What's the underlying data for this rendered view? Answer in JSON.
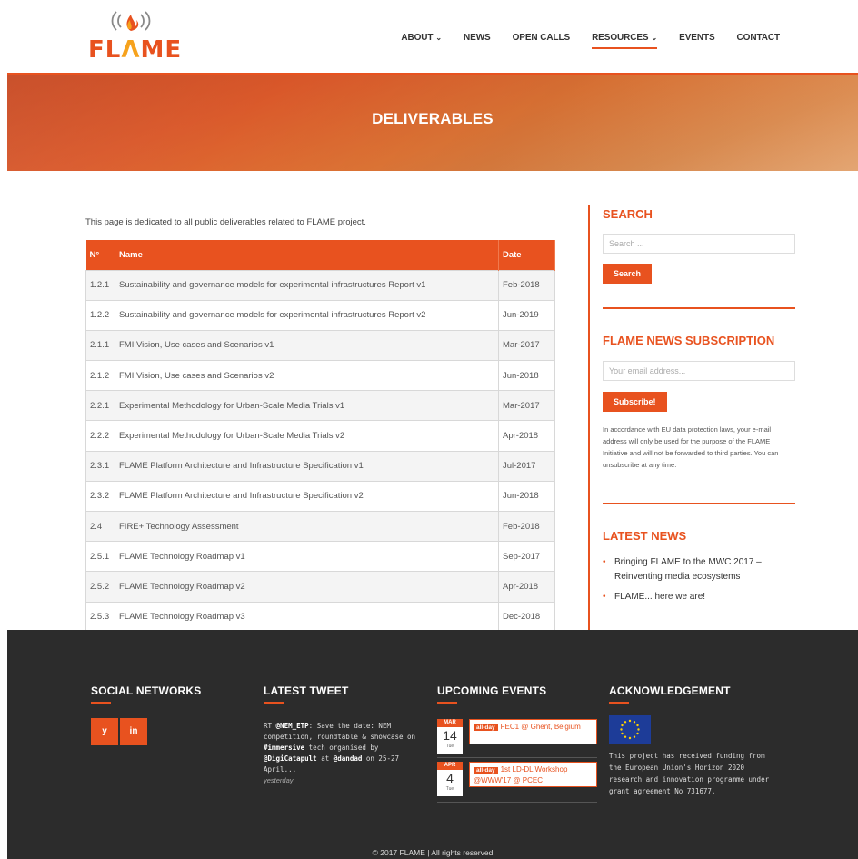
{
  "logo": {
    "text_part1": "FL",
    "text_part2": "Λ",
    "text_part3": "ME"
  },
  "nav": [
    {
      "label": "ABOUT",
      "has_dropdown": true
    },
    {
      "label": "NEWS",
      "has_dropdown": false
    },
    {
      "label": "OPEN CALLS",
      "has_dropdown": false
    },
    {
      "label": "RESOURCES",
      "has_dropdown": true,
      "active": true
    },
    {
      "label": "EVENTS",
      "has_dropdown": false
    },
    {
      "label": "CONTACT",
      "has_dropdown": false
    }
  ],
  "banner": {
    "title": "DELIVERABLES"
  },
  "intro": "This page is dedicated to all public deliverables related to FLAME project.",
  "table": {
    "headers": [
      "N°",
      "Name",
      "Date"
    ],
    "rows": [
      [
        "1.2.1",
        "Sustainability and governance models for experimental infrastructures Report v1",
        "Feb-2018"
      ],
      [
        "1.2.2",
        "Sustainability and governance models for experimental infrastructures Report v2",
        "Jun-2019"
      ],
      [
        "2.1.1",
        "FMI Vision, Use cases and Scenarios v1",
        "Mar-2017"
      ],
      [
        "2.1.2",
        "FMI Vision, Use cases and Scenarios v2",
        "Jun-2018"
      ],
      [
        "2.2.1",
        "Experimental Methodology for Urban-Scale Media Trials v1",
        "Mar-2017"
      ],
      [
        "2.2.2",
        "Experimental Methodology for Urban-Scale Media Trials v2",
        "Apr-2018"
      ],
      [
        "2.3.1",
        "FLAME Platform Architecture and Infrastructure Specification v1",
        "Jul-2017"
      ],
      [
        "2.3.2",
        "FLAME Platform Architecture and Infrastructure Specification v2",
        "Jun-2018"
      ],
      [
        "2.4",
        "FIRE+ Technology Assessment",
        "Feb-2018"
      ],
      [
        "2.5.1",
        "FLAME Technology Roadmap v1",
        "Sep-2017"
      ],
      [
        "2.5.2",
        "FLAME Technology Roadmap v2",
        "Apr-2018"
      ],
      [
        "2.5.3",
        "FLAME Technology Roadmap v3",
        "Dec-2018"
      ]
    ]
  },
  "sidebar": {
    "search": {
      "title": "SEARCH",
      "placeholder": "Search ...",
      "button": "Search"
    },
    "subscription": {
      "title": "FLAME NEWS SUBSCRIPTION",
      "placeholder": "Your email address...",
      "button": "Subscribe!",
      "note": "In accordance with EU data protection laws, your e-mail address will only be used for the purpose of the FLAME Initiative and will not be forwarded to third parties. You can unsubscribe at any time."
    },
    "latest_news": {
      "title": "LATEST NEWS",
      "items": [
        "Bringing FLAME to the MWC 2017 – Reinventing media ecosystems",
        "FLAME... here we are!"
      ]
    }
  },
  "footer": {
    "social": {
      "title": "SOCIAL NETWORKS",
      "twitter": "y",
      "linkedin": "in"
    },
    "tweet": {
      "title": "LATEST TWEET",
      "prefix": "RT ",
      "handle1": "@NEM_ETP",
      "text1": ": Save the date: NEM competition, roundtable & showcase on ",
      "hashtag": "#immersive",
      "text2": " tech organised by ",
      "handle2": "@DigiCatapult",
      "text3": " at ",
      "handle3": "@dandad",
      "text4": " on 25-27 April...",
      "when": "yesterday"
    },
    "events": {
      "title": "UPCOMING EVENTS",
      "items": [
        {
          "month": "MAR",
          "day": "14",
          "dow": "Tue",
          "badge": "all-day",
          "title": "FEC1 @ Ghent, Belgium"
        },
        {
          "month": "APR",
          "day": "4",
          "dow": "Tue",
          "badge": "all-day",
          "title": "1st LD-DL Workshop @WWW'17 @ PCEC"
        }
      ]
    },
    "ack": {
      "title": "ACKNOWLEDGEMENT",
      "text": "This project has received funding from the European Union's Horizon 2020 research and innovation programme under grant agreement No 731677."
    },
    "copyright": "© 2017 FLAME | All rights reserved"
  },
  "colors": {
    "accent": "#e8521f",
    "footer_bg": "#2c2c2c"
  },
  "icons": {
    "nav_dropdown": "chevron-down-icon",
    "logo": "flame-wifi-icon"
  }
}
